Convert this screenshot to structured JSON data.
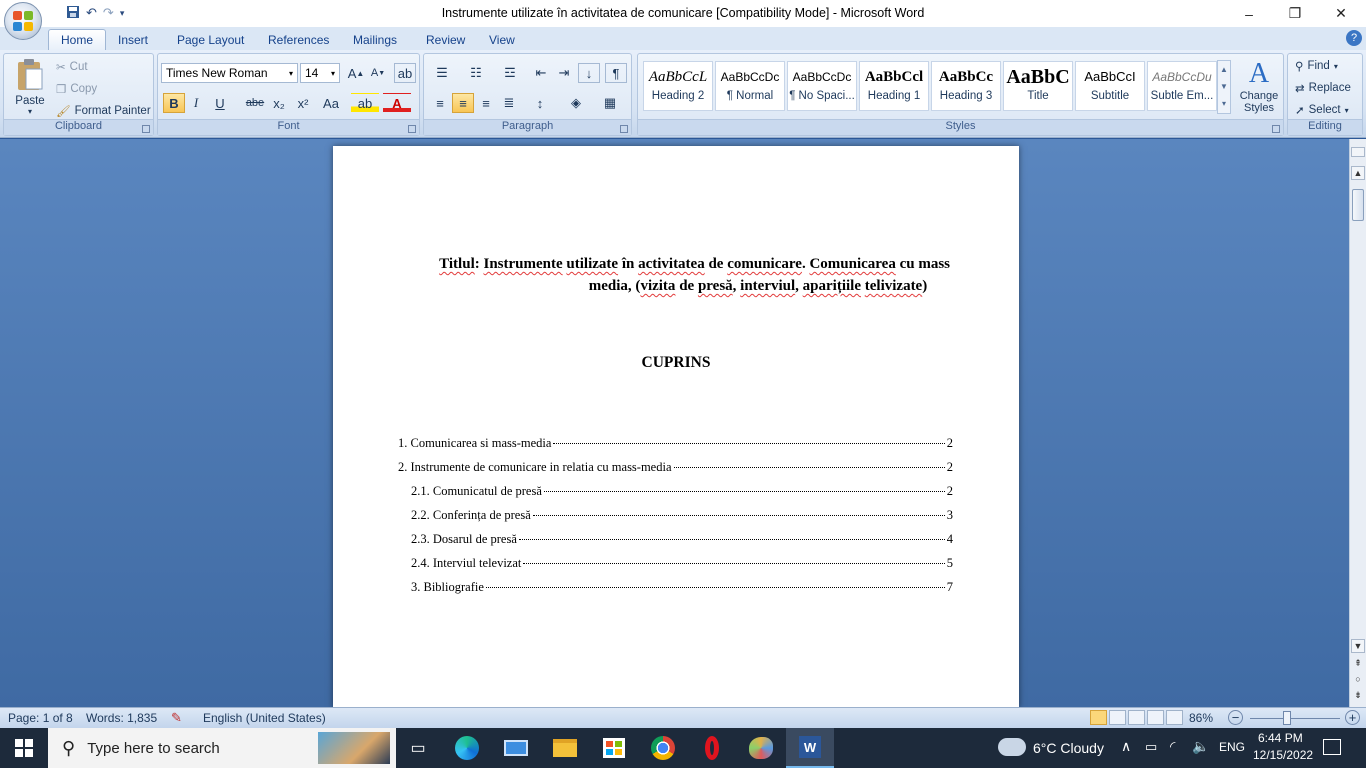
{
  "window": {
    "title": "Instrumente utilizate în activitatea de comunicare [Compatibility Mode] - Microsoft Word",
    "controls": {
      "minimize": "–",
      "restore": "❐",
      "close": "✕"
    }
  },
  "qat": {
    "save_icon": "save-icon",
    "undo_icon": "undo-icon",
    "redo_icon": "redo-icon"
  },
  "tabs": [
    "Home",
    "Insert",
    "Page Layout",
    "References",
    "Mailings",
    "Review",
    "View"
  ],
  "clipboard": {
    "label": "Clipboard",
    "paste": "Paste",
    "cut": "Cut",
    "copy": "Copy",
    "format_painter": "Format Painter"
  },
  "font": {
    "label": "Font",
    "name": "Times New Roman",
    "size": "14",
    "bold": "B",
    "italic": "I",
    "underline": "U",
    "strike": "abe",
    "subscript": "x₂",
    "superscript": "x²",
    "change_case": "Aa"
  },
  "paragraph": {
    "label": "Paragraph"
  },
  "styles": {
    "label": "Styles",
    "items": [
      {
        "preview": "AaBbCcL",
        "name": "Heading 2"
      },
      {
        "preview": "AaBbCcDc",
        "name": "¶ Normal"
      },
      {
        "preview": "AaBbCcDc",
        "name": "¶ No Spaci..."
      },
      {
        "preview": "AaBbCcl",
        "name": "Heading 1"
      },
      {
        "preview": "AaBbCc",
        "name": "Heading 3"
      },
      {
        "preview": "AaBbC",
        "name": "Title"
      },
      {
        "preview": "AaBbCcI",
        "name": "Subtitle"
      },
      {
        "preview": "AaBbCcDu",
        "name": "Subtle Em..."
      }
    ],
    "change_styles": "Change Styles"
  },
  "editing": {
    "label": "Editing",
    "find": "Find",
    "replace": "Replace",
    "select": "Select"
  },
  "document": {
    "title_line1_parts": [
      "Titlul",
      ": ",
      "Instrumente",
      " ",
      "utilizate",
      " în ",
      "activitatea",
      " de ",
      "comunicare",
      ". ",
      "Comunicarea",
      " cu mass"
    ],
    "title_line2_parts": [
      "media, (",
      "vizita",
      " de ",
      "presă",
      ", ",
      "interviul",
      ", ",
      "aparițiile",
      " ",
      "telivizate",
      ")"
    ],
    "heading": "CUPRINS",
    "toc": [
      {
        "text": "1.  Comunicarea si mass-media",
        "page": "2"
      },
      {
        "text": "2.  Instrumente de comunicare in relatia cu mass-media",
        "page": "2"
      },
      {
        "text": "2.1. Comunicatul de presă",
        "page": "2"
      },
      {
        "text": "2.2. Conferința de presă",
        "page": "3"
      },
      {
        "text": "2.3. Dosarul de presă",
        "page": "4"
      },
      {
        "text": "2.4. Interviul televizat",
        "page": "5"
      },
      {
        "text": "3.  Bibliografie",
        "page": "7"
      }
    ]
  },
  "status": {
    "page": "Page: 1 of 8",
    "words": "Words: 1,835",
    "language": "English (United States)",
    "zoom": "86%"
  },
  "taskbar": {
    "search_placeholder": "Type here to search",
    "weather": "6°C  Cloudy",
    "lang": "ENG",
    "time": "6:44 PM",
    "date": "12/15/2022"
  },
  "colors": {
    "accent": "#2b579a",
    "ribbon": "#dbe7f5",
    "highlight": "#f8c555"
  }
}
